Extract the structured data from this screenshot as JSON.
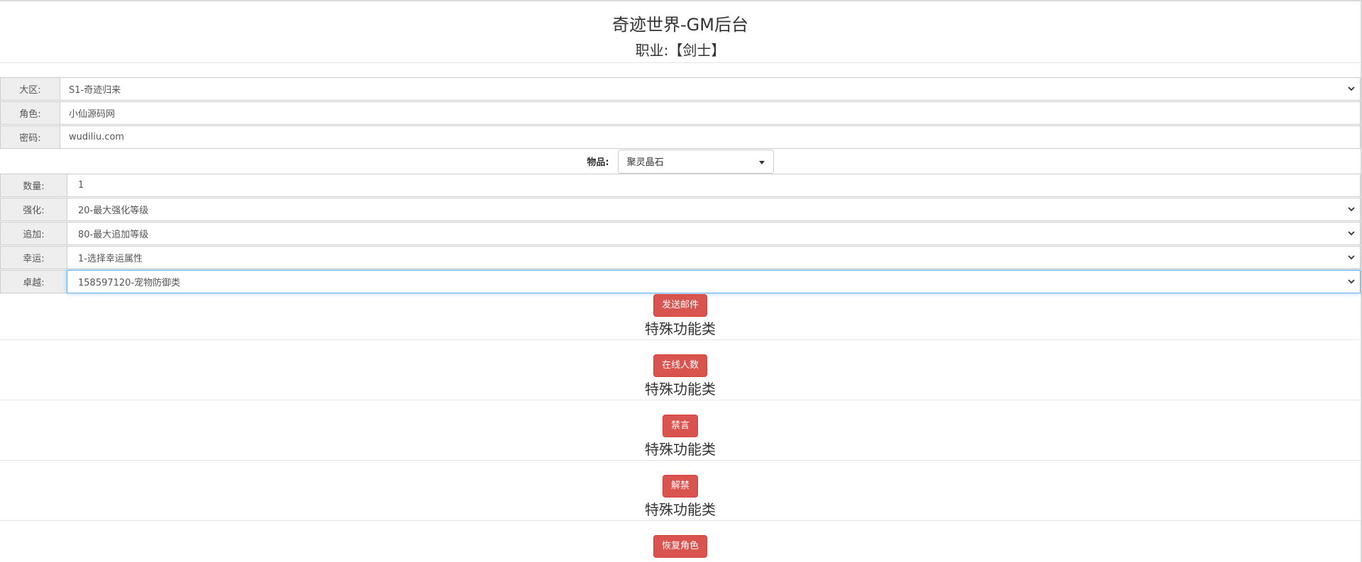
{
  "header": {
    "title": "奇迹世界-GM后台",
    "subtitle": "职业:【剑士】"
  },
  "form": {
    "region": {
      "label": "大区:",
      "value": "S1-奇迹归来"
    },
    "role": {
      "label": "角色:",
      "value": "小仙源码网"
    },
    "password": {
      "label": "密码:",
      "value": "wudiliu.com"
    },
    "item": {
      "label": "物品:",
      "value": "聚灵晶石"
    },
    "quantity": {
      "label": "数量:",
      "value": "1"
    },
    "enhance": {
      "label": "强化:",
      "value": "20-最大强化等级"
    },
    "append": {
      "label": "追加:",
      "value": "80-最大追加等级"
    },
    "luck": {
      "label": "幸运:",
      "value": "1-选择幸运属性"
    },
    "excellent": {
      "label": "卓越:",
      "value": "158597120-宠物防御类"
    }
  },
  "actions": {
    "send_mail": "发送邮件",
    "online_count": "在线人数",
    "mute": "禁言",
    "unmute": "解禁",
    "restore_role": "恢复角色"
  },
  "sections": {
    "special_1": "特殊功能类",
    "special_2": "特殊功能类",
    "special_3": "特殊功能类",
    "special_4": "特殊功能类"
  },
  "icons": {
    "select_chevron": "chevron-down-icon",
    "dropdown_caret": "caret-down-icon"
  },
  "colors": {
    "danger": "#d9534f",
    "focus": "#66afe9"
  }
}
